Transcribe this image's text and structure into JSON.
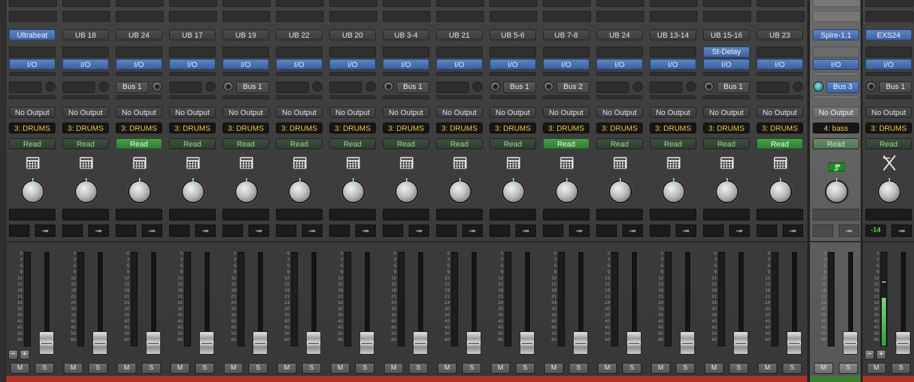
{
  "colors": {
    "blue_button": "#4a71b1",
    "group_text": "#f4c53a",
    "read_text": "#8fe08c",
    "read_on": "#3c8f3f",
    "color_bar_red": "#b03224",
    "color_bar_green": "#3f7d31"
  },
  "strip_labels": {
    "io": "I/O",
    "output": "No Output",
    "mute": "M",
    "solo": "S",
    "minus": "−",
    "plus": "+"
  },
  "meter_scale": [
    "0",
    "3",
    "6",
    "9",
    "12",
    "15",
    "18",
    "21",
    "24",
    "30",
    "35",
    "40",
    "45",
    "50",
    "60"
  ],
  "channels": [
    {
      "name": "Ultrabeat",
      "name_blue": true,
      "insert": "",
      "send": "",
      "send_knob": "empty",
      "group": "3: DRUMS",
      "auto": "Read",
      "auto_on": false,
      "icon": "drum-machine-icon",
      "vol_left": "",
      "vol_right": "-∞",
      "aux": false,
      "plusminus": true,
      "meter_level": 0
    },
    {
      "name": "UB 18",
      "name_blue": false,
      "insert": "",
      "send": "",
      "send_knob": "empty",
      "group": "3: DRUMS",
      "auto": "Read",
      "auto_on": false,
      "icon": "drum-machine-icon",
      "vol_left": "",
      "vol_right": "-∞",
      "aux": false,
      "plusminus": false,
      "meter_level": 0
    },
    {
      "name": "UB 24",
      "name_blue": false,
      "insert": "",
      "send": "Bus 1",
      "send_knob": "right",
      "group": "3: DRUMS",
      "auto": "Read",
      "auto_on": true,
      "icon": "drum-machine-icon",
      "vol_left": "",
      "vol_right": "-∞",
      "aux": false,
      "plusminus": false,
      "meter_level": 0
    },
    {
      "name": "UB 17",
      "name_blue": false,
      "insert": "",
      "send": "",
      "send_knob": "empty",
      "group": "3: DRUMS",
      "auto": "Read",
      "auto_on": false,
      "icon": "drum-machine-icon",
      "vol_left": "",
      "vol_right": "-∞",
      "aux": false,
      "plusminus": false,
      "meter_level": 0
    },
    {
      "name": "UB 19",
      "name_blue": false,
      "insert": "",
      "send": "Bus 1",
      "send_knob": "left",
      "group": "3: DRUMS",
      "auto": "Read",
      "auto_on": false,
      "icon": "drum-machine-icon",
      "vol_left": "",
      "vol_right": "-∞",
      "aux": false,
      "plusminus": false,
      "meter_level": 0
    },
    {
      "name": "UB 22",
      "name_blue": false,
      "insert": "",
      "send": "",
      "send_knob": "empty",
      "group": "3: DRUMS",
      "auto": "Read",
      "auto_on": false,
      "icon": "drum-machine-icon",
      "vol_left": "",
      "vol_right": "-∞",
      "aux": false,
      "plusminus": false,
      "meter_level": 0
    },
    {
      "name": "UB 20",
      "name_blue": false,
      "insert": "",
      "send": "",
      "send_knob": "empty",
      "group": "3: DRUMS",
      "auto": "Read",
      "auto_on": false,
      "icon": "drum-machine-icon",
      "vol_left": "",
      "vol_right": "-∞",
      "aux": false,
      "plusminus": false,
      "meter_level": 0
    },
    {
      "name": "UB 3-4",
      "name_blue": false,
      "insert": "",
      "send": "Bus 1",
      "send_knob": "left",
      "group": "3: DRUMS",
      "auto": "Read",
      "auto_on": false,
      "icon": "drum-machine-icon",
      "vol_left": "",
      "vol_right": "-∞",
      "aux": false,
      "plusminus": false,
      "meter_level": 0
    },
    {
      "name": "UB 21",
      "name_blue": false,
      "insert": "",
      "send": "",
      "send_knob": "empty",
      "group": "3: DRUMS",
      "auto": "Read",
      "auto_on": false,
      "icon": "drum-machine-icon",
      "vol_left": "",
      "vol_right": "-∞",
      "aux": false,
      "plusminus": false,
      "meter_level": 0
    },
    {
      "name": "UB 5-6",
      "name_blue": false,
      "insert": "",
      "send": "Bus 1",
      "send_knob": "left",
      "group": "3: DRUMS",
      "auto": "Read",
      "auto_on": false,
      "icon": "drum-machine-icon",
      "vol_left": "",
      "vol_right": "-∞",
      "aux": false,
      "plusminus": false,
      "meter_level": 0
    },
    {
      "name": "UB 7-8",
      "name_blue": false,
      "insert": "",
      "send": "Bus 2",
      "send_knob": "left",
      "group": "3: DRUMS",
      "auto": "Read",
      "auto_on": true,
      "icon": "drum-machine-icon",
      "vol_left": "",
      "vol_right": "-∞",
      "aux": false,
      "plusminus": false,
      "meter_level": 0
    },
    {
      "name": "UB 24",
      "name_blue": false,
      "insert": "",
      "send": "",
      "send_knob": "empty",
      "group": "3: DRUMS",
      "auto": "Read",
      "auto_on": false,
      "icon": "drum-machine-icon",
      "vol_left": "",
      "vol_right": "-∞",
      "aux": false,
      "plusminus": false,
      "meter_level": 0
    },
    {
      "name": "UB 13-14",
      "name_blue": false,
      "insert": "",
      "send": "",
      "send_knob": "empty",
      "group": "3: DRUMS",
      "auto": "Read",
      "auto_on": false,
      "icon": "drum-machine-icon",
      "vol_left": "",
      "vol_right": "-∞",
      "aux": false,
      "plusminus": false,
      "meter_level": 0
    },
    {
      "name": "UB 15-16",
      "name_blue": false,
      "insert": "St-Delay",
      "send": "Bus 1",
      "send_knob": "left",
      "group": "3: DRUMS",
      "auto": "Read",
      "auto_on": false,
      "icon": "drum-machine-icon",
      "vol_left": "",
      "vol_right": "-∞",
      "aux": false,
      "plusminus": false,
      "meter_level": 0
    },
    {
      "name": "UB 23",
      "name_blue": false,
      "insert": "",
      "send": "",
      "send_knob": "empty",
      "group": "3: DRUMS",
      "auto": "Read",
      "auto_on": true,
      "icon": "drum-machine-icon",
      "vol_left": "",
      "vol_right": "-∞",
      "aux": false,
      "plusminus": false,
      "meter_level": 0
    },
    {
      "name": "Spire-1.1",
      "name_blue": true,
      "insert": "",
      "send": "Bus 3",
      "send_knob": "teal",
      "group": "4: bass",
      "auto": "Read",
      "auto_on": false,
      "icon": "synth-green-icon",
      "vol_left": "",
      "vol_right": "-∞",
      "aux": true,
      "plusminus": false,
      "meter_level": 0
    },
    {
      "name": "EXS24",
      "name_blue": true,
      "insert": "",
      "send": "Bus 1",
      "send_knob": "left",
      "group": "3: DRUMS",
      "auto": "Read",
      "auto_on": false,
      "icon": "drumsticks-icon",
      "vol_left": "-14",
      "vol_right": "-∞",
      "aux": false,
      "plusminus": true,
      "meter_level": 0.52
    }
  ]
}
